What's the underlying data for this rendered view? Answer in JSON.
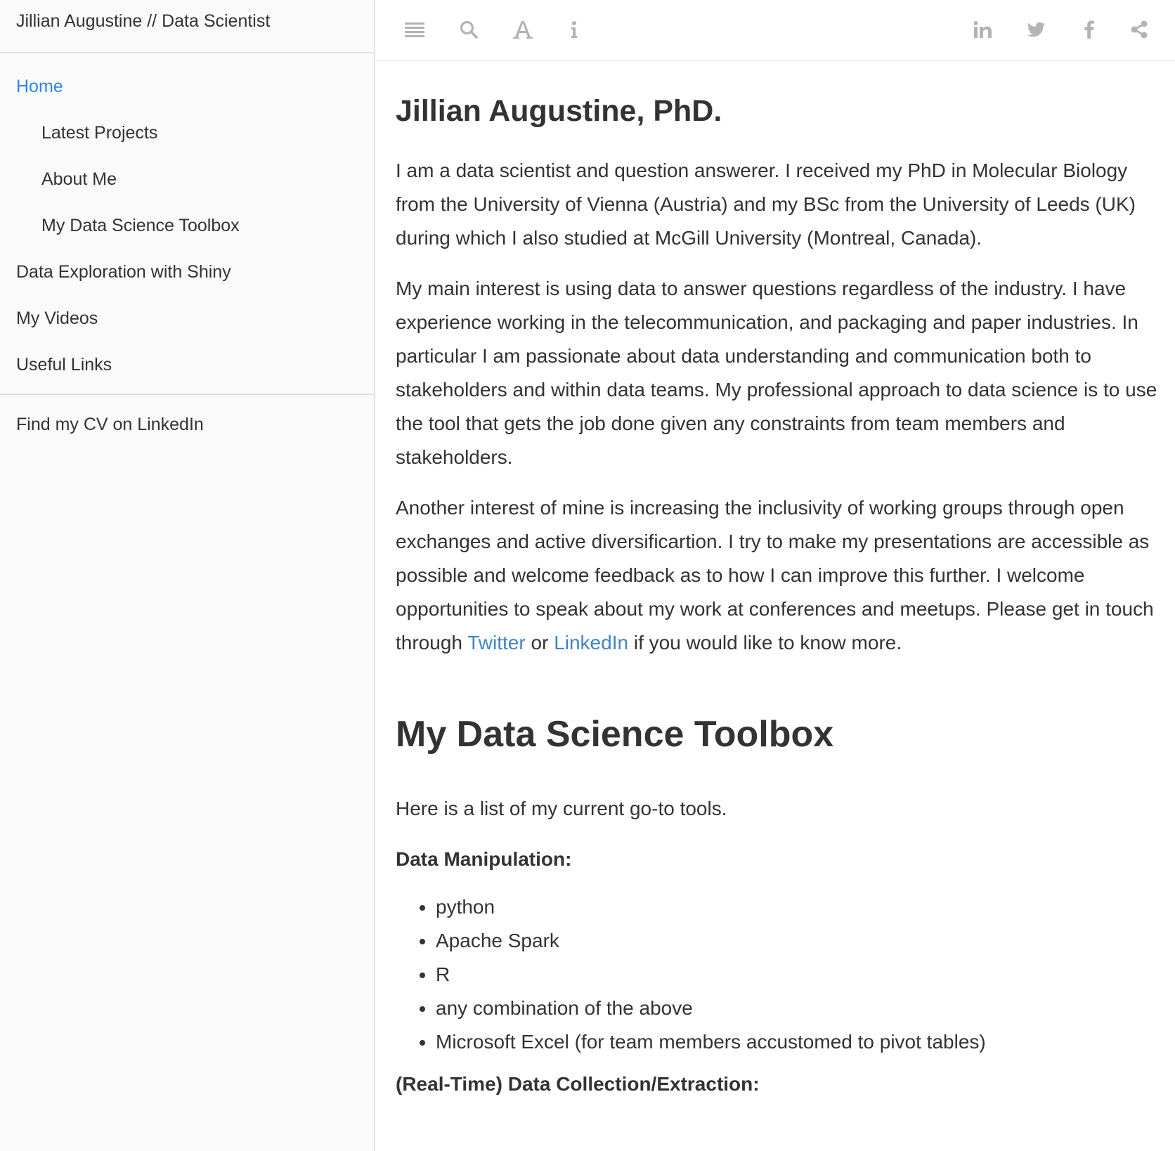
{
  "sidebar": {
    "header": "Jillian Augustine // Data Scientist",
    "nav": [
      {
        "label": "Home",
        "active": true,
        "level": 0
      },
      {
        "label": "Latest Projects",
        "level": 1
      },
      {
        "label": "About Me",
        "level": 1
      },
      {
        "label": "My Data Science Toolbox",
        "level": 1
      },
      {
        "label": "Data Exploration with Shiny",
        "level": 0
      },
      {
        "label": "My Videos",
        "level": 0
      },
      {
        "label": "Useful Links",
        "level": 0
      }
    ],
    "cv_link": "Find my CV on LinkedIn"
  },
  "toolbar": {
    "left_icons": [
      "menu-icon",
      "search-icon",
      "font-icon",
      "info-icon"
    ],
    "right_icons": [
      "linkedin-icon",
      "twitter-icon",
      "facebook-icon",
      "share-icon"
    ],
    "icon_color": "#b3b3b3"
  },
  "main": {
    "title": "Jillian Augustine, PhD.",
    "p1": "I am a data scientist and question answerer. I received my PhD in Molecular Biology from the University of Vienna (Austria) and my BSc from the University of Leeds (UK) during which I also studied at McGill University (Montreal, Canada).",
    "p2": "My main interest is using data to answer questions regardless of the industry. I have experience working in the telecommunication, and packaging and paper industries. In particular I am passionate about data understanding and communication both to stakeholders and within data teams. My professional approach to data science is to use the tool that gets the job done given any constraints from team members and stakeholders.",
    "p3_before": "Another interest of mine is increasing the inclusivity of working groups through open exchanges and active diversificartion. I try to make my presentations are accessible as possible and welcome feedback as to how I can improve this further. I welcome opportunities to speak about my work at conferences and meetups. Please get in touch through ",
    "p3_link1": "Twitter",
    "p3_mid": " or ",
    "p3_link2": "LinkedIn",
    "p3_after": " if you would like to know more.",
    "toolbox_heading": "My Data Science Toolbox",
    "toolbox_intro": "Here is a list of my current go-to tools.",
    "data_manipulation_heading": "Data Manipulation:",
    "data_manipulation_items": [
      "python",
      "Apache Spark",
      "R",
      "any combination of the above",
      "Microsoft Excel (for team members accustomed to pivot tables)"
    ],
    "collection_heading": "(Real-Time) Data Collection/Extraction:"
  },
  "colors": {
    "accent": "#2f88d8",
    "link": "#4183c4",
    "text": "#333333",
    "sidebar_bg": "#fafafa"
  }
}
